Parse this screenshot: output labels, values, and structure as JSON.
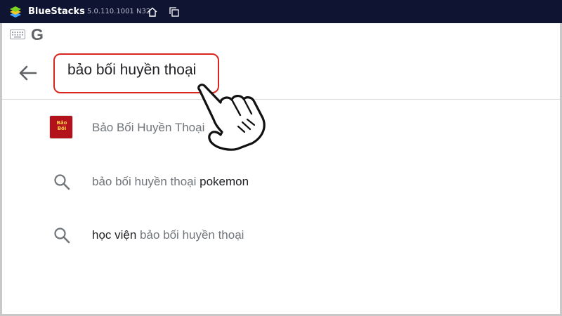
{
  "titlebar": {
    "app_name": "BlueStacks",
    "version": "5.0.110.1001 N32",
    "icons": [
      "bluestacks-logo-icon",
      "home-icon",
      "multi-instance-icon"
    ],
    "background": "#0f1432"
  },
  "strip": {
    "icons": [
      "keyboard-icon"
    ],
    "logo_text": "G"
  },
  "search": {
    "query": "bảo bối huyền thoại",
    "highlight_color": "#d9251d"
  },
  "suggestions": [
    {
      "type": "app",
      "text": "Bảo Bối Huyền Thoại",
      "icon": "app-icon",
      "icon_text": "Bảo Bối"
    },
    {
      "type": "query",
      "match": "bảo bối huyền thoại",
      "extra": " pokemon",
      "icon": "search-icon"
    },
    {
      "type": "query",
      "prefix": "học viện",
      "match": " bảo bối huyền thoại",
      "icon": "search-icon"
    }
  ]
}
